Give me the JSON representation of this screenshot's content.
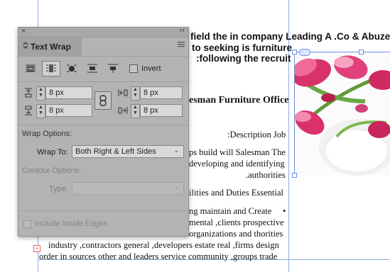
{
  "document": {
    "lines": [
      "field the in company Leading A .Co & Abuzeid",
      "to seeking is furniture",
      ":following the recruit",
      "esman Furniture Office",
      ":Description Job",
      "ps build will Salesman The",
      "developing and identifying",
      ".authorities",
      "ilities and Duties Essential",
      "ng maintain and Create",
      "mental ,clients prospective",
      "organizations and thorities",
      "industry ,contractors general ,developers estate real ,firms design",
      "order in sources other and leaders service community ,groups trade"
    ],
    "bullet": "•",
    "overset_marker": "+"
  },
  "panel": {
    "close_glyph": "×",
    "collapse_glyph": "‹‹",
    "tab_chevron": "⌃⌄",
    "title": "Text Wrap",
    "icons": [
      "no-wrap-icon",
      "wrap-bounding-box-icon",
      "wrap-object-shape-icon",
      "jump-object-icon",
      "jump-next-column-icon"
    ],
    "active_wrap_index": 1,
    "invert": {
      "label": "Invert",
      "checked": false
    },
    "offsets": {
      "top": "8 px",
      "bottom": "8 px",
      "left": "8 px",
      "right": "8 px"
    },
    "wrap_options_label": "Wrap Options:",
    "wrap_to": {
      "label": "Wrap To:",
      "value": "Both Right & Left Sides"
    },
    "contour_options_label": "Contour Options:",
    "type": {
      "label": "Type:",
      "value": ""
    },
    "include_inside_edges": {
      "label": "Include Inside Edges",
      "checked": false,
      "enabled": false
    }
  },
  "colors": {
    "guide": "#8fa8e8",
    "panel_bg": "#b3b3b3",
    "frame_selection": "#6d8fe0",
    "overset": "#e06060"
  }
}
